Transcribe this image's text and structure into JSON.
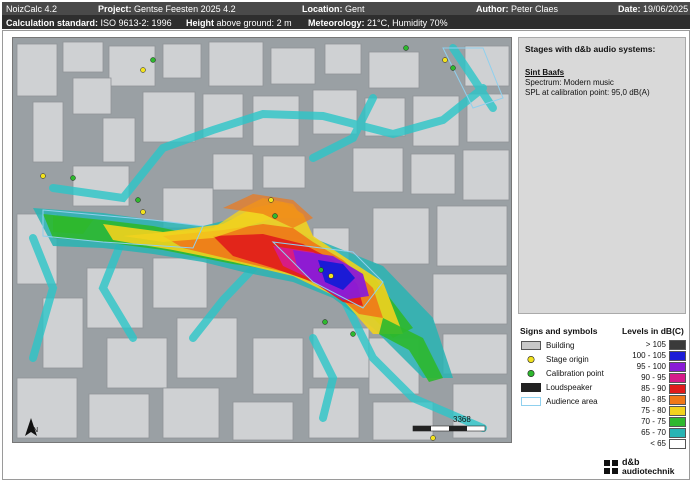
{
  "header": {
    "app": "NoizCalc 4.2",
    "project_label": "Project:",
    "project_value": "Gentse Feesten 2025 4.2",
    "location_label": "Location:",
    "location_value": "Gent",
    "author_label": "Author:",
    "author_value": "Peter Claes",
    "date_label": "Date:",
    "date_value": "19/06/2025"
  },
  "subheader": {
    "standard_label": "Calculation standard:",
    "standard_value": "ISO 9613-2: 1996",
    "height_label": "Height",
    "height_value": "above ground: 2 m",
    "meteo_label": "Meteorology:",
    "meteo_value": "21°C, Humidity 70%"
  },
  "info": {
    "heading": "Stages with d&b audio systems:",
    "stage_name": "Sint Baafs",
    "spectrum": "Spectrum:   Modern music",
    "spl": "SPL at calibration point:  95,0 dB(A)"
  },
  "signs": {
    "title": "Signs and symbols",
    "items": [
      {
        "label": "Building",
        "type": "building"
      },
      {
        "label": "Stage origin",
        "type": "stage"
      },
      {
        "label": "Calibration point",
        "type": "calib"
      },
      {
        "label": "Loudspeaker",
        "type": "speaker"
      },
      {
        "label": "Audience area",
        "type": "audience"
      }
    ]
  },
  "levels": {
    "title": "Levels in dB(C)",
    "items": [
      {
        "label": "> 105",
        "color": "#3a3a3a"
      },
      {
        "label": "100 - 105",
        "color": "#1b1bd6"
      },
      {
        "label": "95 - 100",
        "color": "#8a1bd6"
      },
      {
        "label": "90 -  95",
        "color": "#d61b8a"
      },
      {
        "label": "85 -  90",
        "color": "#e01b1b"
      },
      {
        "label": "80 -  85",
        "color": "#f07818"
      },
      {
        "label": "75 -  80",
        "color": "#f2d21e"
      },
      {
        "label": "70 -  75",
        "color": "#2eb82e"
      },
      {
        "label": "65 -  70",
        "color": "#28b4b4"
      },
      {
        "label": "< 65",
        "color": "#ffffff"
      }
    ]
  },
  "map": {
    "scale_label": "3368",
    "north_label": "N"
  },
  "logo": {
    "line1": "d&b",
    "line2": "audiotechnik"
  }
}
